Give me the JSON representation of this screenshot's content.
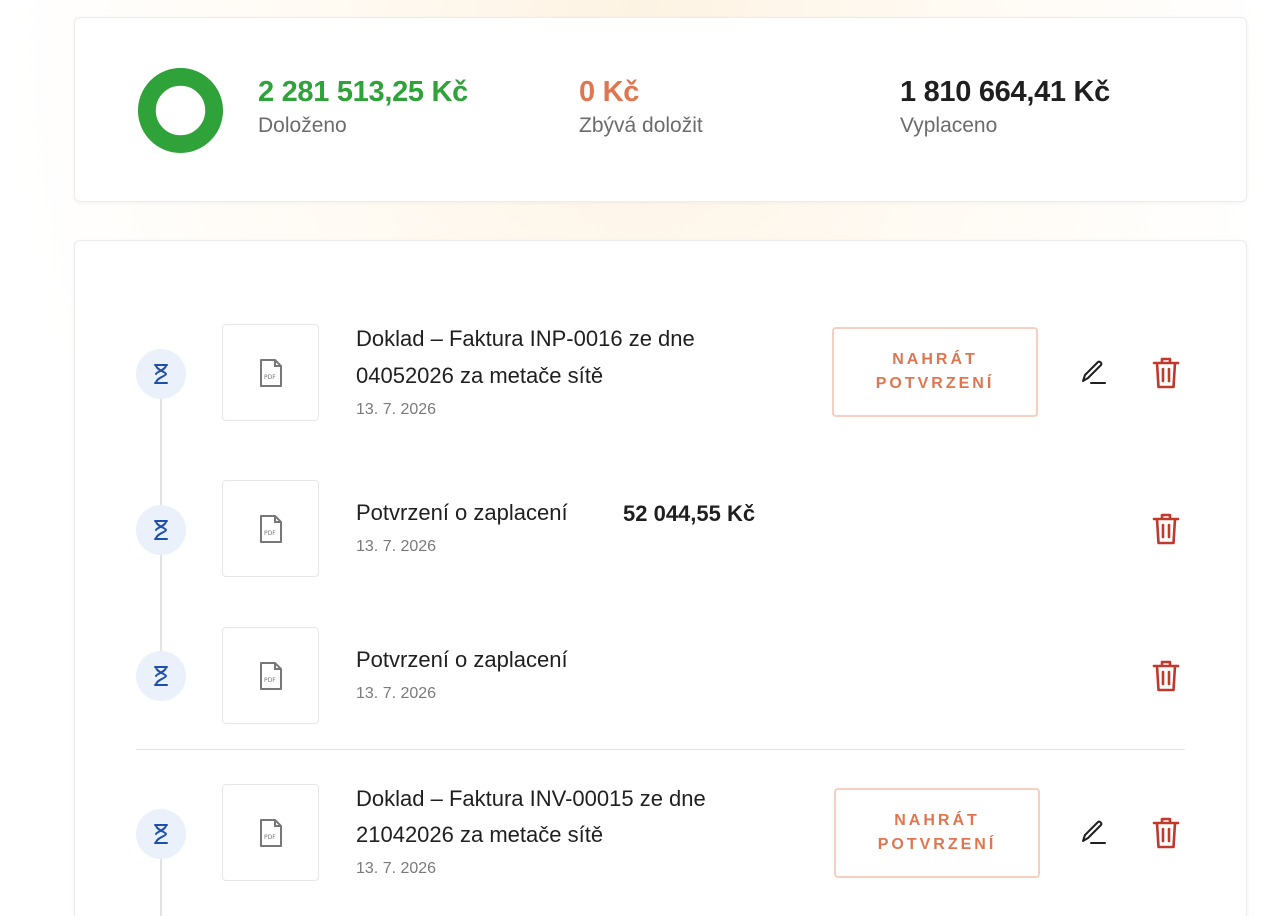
{
  "summary": {
    "progress": 1.0,
    "progress_color": "#2fa23a",
    "doloženo_value": "2 281 513,25 Kč",
    "doloženo_label": "Doloženo",
    "zbyva_value": "0 Kč",
    "zbyva_label": "Zbývá doložit",
    "vyplaceno_value": "1 810 664,41 Kč",
    "vyplaceno_label": "Vyplaceno"
  },
  "colors": {
    "green": "#2fa23a",
    "orange": "#e0764f",
    "delete_red": "#c0392b",
    "status_blue": "#1f4fa8"
  },
  "documents": [
    {
      "title_line1": "Doklad – Faktura INP-0016 ze dne",
      "title_line2": "04052026 za metače sítě",
      "date": "13. 7. 2026",
      "upload_label_line1": "NAHRÁT",
      "upload_label_line2": "POTVRZENÍ",
      "status_icon": "hourglass-icon",
      "file_icon": "pdf-file-icon"
    },
    {
      "title": "Potvrzení o zaplacení",
      "amount": "52 044,55 Kč",
      "date": "13. 7. 2026",
      "status_icon": "hourglass-icon",
      "file_icon": "pdf-file-icon"
    },
    {
      "title": "Potvrzení o zaplacení",
      "date": "13. 7. 2026",
      "status_icon": "hourglass-icon",
      "file_icon": "pdf-file-icon"
    },
    {
      "title_line1": "Doklad – Faktura INV-00015 ze dne",
      "title_line2": "21042026 za metače sítě",
      "date": "13. 7. 2026",
      "upload_label_line1": "NAHRÁT",
      "upload_label_line2": "POTVRZENÍ",
      "status_icon": "hourglass-icon",
      "file_icon": "pdf-file-icon"
    }
  ]
}
